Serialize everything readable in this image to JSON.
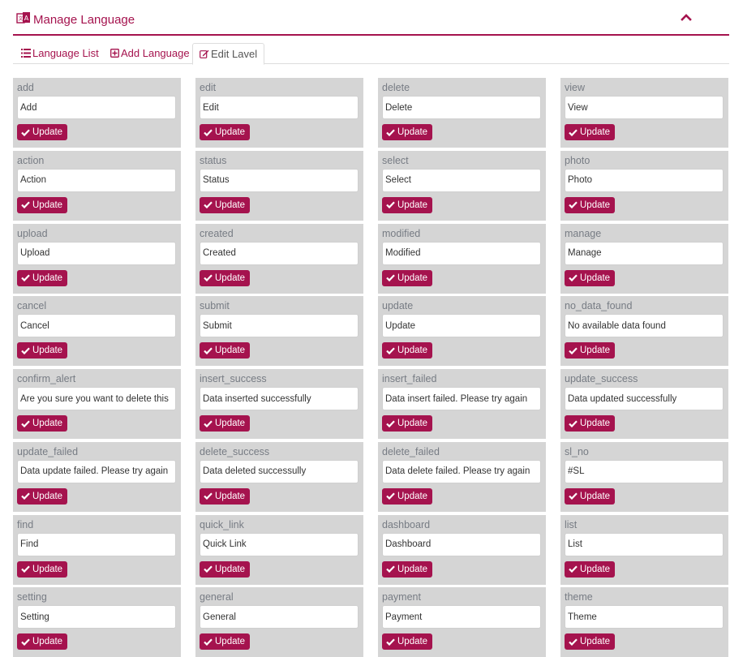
{
  "header": {
    "title": "Manage Language"
  },
  "tabs": [
    {
      "label": "Language List"
    },
    {
      "label": "Add Language"
    },
    {
      "label": "Edit Lavel"
    }
  ],
  "button_label": "Update",
  "entries": [
    {
      "key": "add",
      "value": "Add"
    },
    {
      "key": "edit",
      "value": "Edit"
    },
    {
      "key": "delete",
      "value": "Delete"
    },
    {
      "key": "view",
      "value": "View"
    },
    {
      "key": "action",
      "value": "Action"
    },
    {
      "key": "status",
      "value": "Status"
    },
    {
      "key": "select",
      "value": "Select"
    },
    {
      "key": "photo",
      "value": "Photo"
    },
    {
      "key": "upload",
      "value": "Upload"
    },
    {
      "key": "created",
      "value": "Created"
    },
    {
      "key": "modified",
      "value": "Modified"
    },
    {
      "key": "manage",
      "value": "Manage"
    },
    {
      "key": "cancel",
      "value": "Cancel"
    },
    {
      "key": "submit",
      "value": "Submit"
    },
    {
      "key": "update",
      "value": "Update"
    },
    {
      "key": "no_data_found",
      "value": "No available data found"
    },
    {
      "key": "confirm_alert",
      "value": "Are you sure you want to delete this"
    },
    {
      "key": "insert_success",
      "value": "Data inserted successfully"
    },
    {
      "key": "insert_failed",
      "value": "Data insert failed. Please try again"
    },
    {
      "key": "update_success",
      "value": "Data updated successfully"
    },
    {
      "key": "update_failed",
      "value": "Data update failed. Please try again"
    },
    {
      "key": "delete_success",
      "value": "Data deleted successully"
    },
    {
      "key": "delete_failed",
      "value": "Data delete failed. Please try again"
    },
    {
      "key": "sl_no",
      "value": "#SL"
    },
    {
      "key": "find",
      "value": "Find"
    },
    {
      "key": "quick_link",
      "value": "Quick Link"
    },
    {
      "key": "dashboard",
      "value": "Dashboard"
    },
    {
      "key": "list",
      "value": "List"
    },
    {
      "key": "setting",
      "value": "Setting"
    },
    {
      "key": "general",
      "value": "General"
    },
    {
      "key": "payment",
      "value": "Payment"
    },
    {
      "key": "theme",
      "value": "Theme"
    }
  ],
  "colors": {
    "accent": "#a5134e",
    "cell_bg": "#d5d5d5"
  }
}
